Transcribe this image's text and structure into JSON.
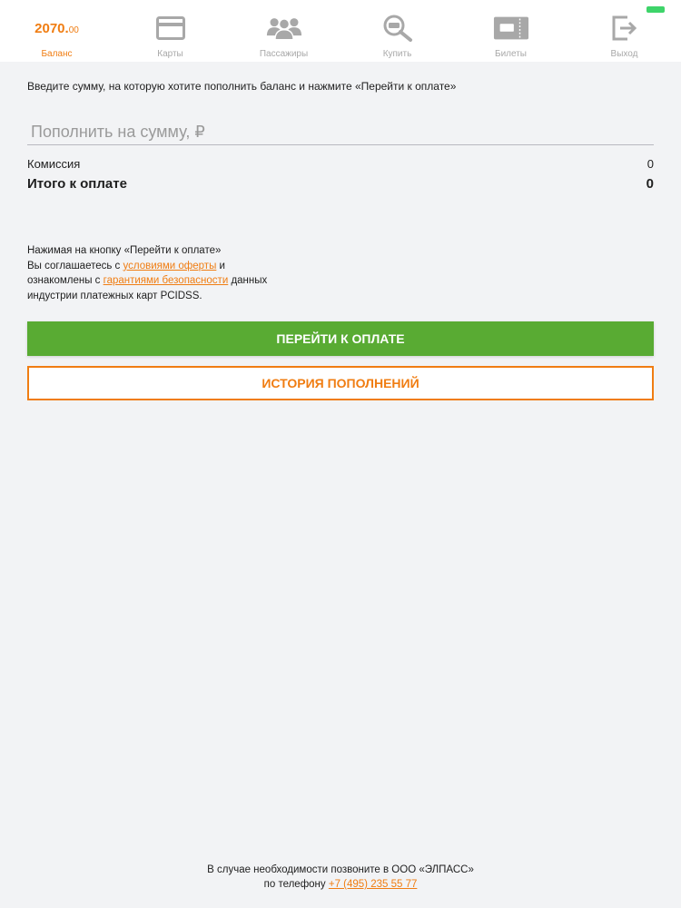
{
  "colors": {
    "accent": "#f07d12",
    "pay_button": "#59ab33",
    "nav_inactive": "#a8a8a8",
    "background": "#f2f3f5"
  },
  "nav": {
    "balance": {
      "value_main": "2070.",
      "value_decimal": "00",
      "label": "Баланс",
      "active": true
    },
    "cards": {
      "label": "Карты",
      "icon": "credit-card-icon"
    },
    "passengers": {
      "label": "Пассажиры",
      "icon": "users-icon"
    },
    "buy": {
      "label": "Купить",
      "icon": "magnifier-icon"
    },
    "tickets": {
      "label": "Билеты",
      "icon": "ticket-icon"
    },
    "logout": {
      "label": "Выход",
      "icon": "logout-icon"
    }
  },
  "main": {
    "instruction": "Введите сумму, на которую хотите пополнить баланс и нажмите «Перейти к оплате»",
    "amount_placeholder": "Пополнить на сумму, ₽",
    "amount_value": "",
    "commission_label": "Комиссия",
    "commission_value": "0",
    "total_label": "Итого к оплате",
    "total_value": "0",
    "agreement": {
      "line1": "Нажимая на кнопку «Перейти к оплате»",
      "line2_prefix": "Вы соглашаетесь с ",
      "offer_link": "условиями оферты",
      "line2_suffix": " и",
      "line3_prefix": "ознакомлены с ",
      "security_link": "гарантиями безопасности",
      "line3_suffix": " данных",
      "line4": "индустрии платежных карт PCIDSS."
    },
    "pay_button": "ПЕРЕЙТИ К ОПЛАТЕ",
    "history_button": "ИСТОРИЯ ПОПОЛНЕНИЙ"
  },
  "footer": {
    "line1": "В случае необходимости позвоните в ООО «ЭЛПАСС»",
    "line2_prefix": "по телефону ",
    "phone": "+7 (495) 235 55 77"
  }
}
